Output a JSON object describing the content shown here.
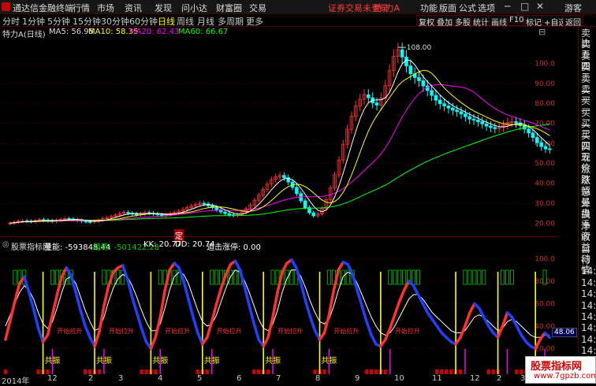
{
  "app": {
    "name": "通达信金融终端"
  },
  "menu": [
    "行情",
    "市场",
    "资讯",
    "发现",
    "问小达",
    "财富圈",
    "交易"
  ],
  "status_warning": "证券交易未登录",
  "stock_tag": "特 力A",
  "top_tools": [
    "功能",
    "版面",
    "公式",
    "选项"
  ],
  "user": "游客",
  "periods": [
    "分时",
    "1分钟",
    "5分钟",
    "15分钟",
    "30分钟",
    "60分钟",
    "日线",
    "周线",
    "月线",
    "多周期",
    "更多"
  ],
  "active_period": "日线",
  "right_tools": [
    "复权",
    "叠加",
    "多股",
    "统计",
    "画线",
    "F10",
    "标记",
    "+自选",
    "返回"
  ],
  "main_legend": {
    "name": "特力A(日线)",
    "ma5": "MA5: 56.95",
    "ma10": "MA10: 58.35",
    "ma20": "MA20: 62.43",
    "ma60": "MA60: 66.67"
  },
  "colors": {
    "ma5": "#ffffff",
    "ma10": "#ffff00",
    "ma20": "#ff00ff",
    "ma60": "#00ff00",
    "up": "#ff3232",
    "down": "#00ffff"
  },
  "price_axis": [
    "100.0",
    "90.00",
    "80.00",
    "70.00",
    "60.00",
    "50.00",
    "40.00",
    "30.00",
    "20.00"
  ],
  "peak_label": "108.00",
  "ind_legend": {
    "name": "股票指标网",
    "vol": "量能: -593848.44",
    "trend": "趋势: -501422.28",
    "kk": "KK: 20.77",
    "dd": "DD: 20.74",
    "stop": "追击涨停: 0.00"
  },
  "ind_axis": [
    "100.0",
    "80.00",
    "60.00",
    "40.00",
    "20.00"
  ],
  "ind_current": "48.06",
  "ind_annotations": [
    "共振",
    "共振",
    "共振",
    "共振",
    "共振",
    "共振"
  ],
  "ind_signals": [
    "开始拉升",
    "开始拉升",
    "开始拉升",
    "开始拉升",
    "开始拉升",
    "开始拉升",
    "开始拉升"
  ],
  "right_panel": [
    "卖比",
    "卖五",
    "卖四",
    "卖三",
    "卖二",
    "卖一",
    "买一",
    "买二",
    "买三",
    "买四",
    "买五",
    "现价",
    "涨跌",
    "涨幅",
    "总量",
    "外盘",
    "换手",
    "净资",
    "收益",
    "自动",
    "行情",
    "14:5",
    "14:5",
    "14:5",
    "14:5",
    "14:5",
    "14:5",
    "14:5",
    "14:5",
    "14:5"
  ],
  "date_axis": [
    "2014年",
    "12",
    "2",
    "3",
    "4",
    "5",
    "6",
    "7",
    "8",
    "9",
    "10",
    "11",
    "12",
    "2",
    "3",
    "4"
  ],
  "fixed_label": "定",
  "watermark": {
    "title": "股票指标网",
    "url": "www.7gpzb.com"
  },
  "main_closes": [
    20.0,
    20.5,
    21.0,
    21.2,
    21.0,
    20.8,
    21.3,
    21.8,
    21.5,
    21.2,
    20.9,
    21.4,
    21.9,
    22.3,
    22.1,
    21.7,
    21.4,
    21.0,
    20.8,
    20.6,
    21.0,
    21.6,
    22.3,
    22.8,
    23.4,
    24.1,
    24.9,
    25.4,
    25.0,
    24.6,
    24.3,
    24.7,
    25.3,
    25.0,
    24.6,
    24.2,
    23.9,
    24.3,
    24.9,
    25.5,
    26.1,
    26.9,
    27.8,
    28.6,
    29.4,
    30.0,
    29.6,
    28.7,
    27.8,
    26.7,
    25.6,
    24.8,
    24.2,
    23.9,
    24.4,
    25.6,
    27.2,
    29.1,
    31.5,
    34.0,
    36.8,
    39.5,
    41.8,
    43.2,
    43.9,
    42.8,
    40.6,
    37.9,
    34.8,
    31.2,
    27.8,
    25.2,
    23.7,
    24.6,
    27.4,
    31.8,
    37.6,
    44.2,
    51.6,
    59.5,
    67.0,
    73.5,
    78.6,
    82.0,
    84.3,
    82.8,
    80.2,
    79.1,
    82.6,
    88.8,
    96.3,
    103.5,
    106.8,
    103.2,
    98.7,
    94.8,
    92.9,
    91.3,
    88.7,
    86.4,
    84.0,
    81.6,
    79.8,
    78.7,
    77.6,
    76.6,
    75.8,
    74.7,
    73.3,
    72.1,
    71.6,
    70.8,
    69.7,
    68.6,
    67.9,
    67.3,
    68.0,
    69.2,
    70.4,
    70.8,
    70.2,
    68.9,
    67.1,
    65.2,
    62.9,
    60.3,
    58.4,
    57.2,
    56.9
  ],
  "ind_fast": [
    28,
    45,
    62,
    78,
    84,
    70,
    55,
    38,
    26,
    32,
    50,
    68,
    84,
    92,
    85,
    70,
    54,
    40,
    30,
    22,
    35,
    58,
    76,
    88,
    92,
    94,
    82,
    66,
    52,
    38,
    26,
    20,
    30,
    48,
    72,
    90,
    96,
    92,
    80,
    64,
    48,
    34,
    24,
    30,
    44,
    60,
    74,
    86,
    95,
    98,
    90,
    75,
    58,
    42,
    28,
    22,
    30,
    48,
    70,
    88,
    96,
    99,
    92,
    78,
    62,
    48,
    36,
    28,
    34,
    50,
    72,
    90,
    97,
    95,
    86,
    72,
    58,
    44,
    32,
    24,
    22,
    28,
    38,
    50,
    62,
    72,
    80,
    76,
    68,
    60,
    52,
    46,
    40,
    34,
    30,
    26,
    24,
    30,
    40,
    52,
    60,
    56,
    48,
    40,
    34,
    30,
    40,
    52,
    48,
    40,
    32,
    26,
    22,
    20,
    28,
    34,
    30
  ],
  "ind_slow": [
    40,
    50,
    60,
    70,
    76,
    72,
    64,
    52,
    42,
    38,
    44,
    56,
    70,
    82,
    84,
    78,
    66,
    54,
    44,
    36,
    38,
    48,
    62,
    74,
    82,
    86,
    84,
    76,
    66,
    54,
    44,
    36,
    36,
    42,
    56,
    72,
    84,
    88,
    86,
    78,
    66,
    54,
    44,
    40,
    42,
    50,
    62,
    74,
    84,
    90,
    88,
    80,
    70,
    58,
    46,
    38,
    36,
    42,
    54,
    70,
    82,
    90,
    90,
    84,
    74,
    62,
    52,
    44,
    42,
    46,
    58,
    72,
    84,
    88,
    86,
    78,
    68,
    58,
    48,
    40,
    34,
    32,
    34,
    40,
    48,
    56,
    64,
    68,
    68,
    64,
    58,
    52,
    48,
    44,
    40,
    36,
    34,
    34,
    36,
    42,
    48,
    50,
    48,
    44,
    40,
    36,
    38,
    44,
    46,
    44,
    40,
    36,
    32,
    30,
    30,
    32,
    32
  ]
}
